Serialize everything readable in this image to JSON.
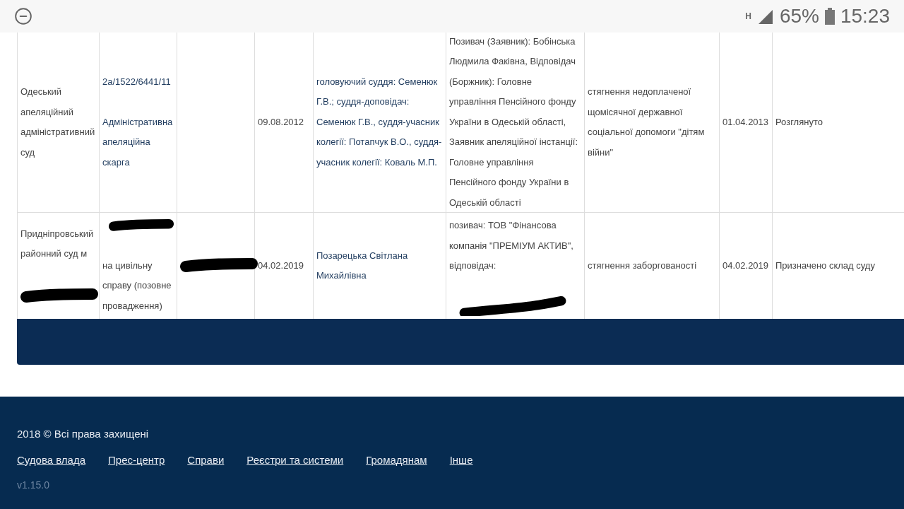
{
  "status_bar": {
    "network_type": "H",
    "battery": "65%",
    "time": "15:23"
  },
  "table": {
    "rows": [
      {
        "cells": [
          {
            "items": [
              {
                "kind": "text",
                "text": "Одеський апеляційний адміністративний суд"
              }
            ]
          },
          {
            "link": true,
            "items": [
              {
                "kind": "text",
                "text": "2а/1522/6441/11"
              },
              {
                "kind": "text",
                "text": "Адміністративна апеляційна скарга"
              }
            ]
          },
          {},
          {
            "items": [
              {
                "kind": "text",
                "text": "09.08.2012"
              }
            ]
          },
          {
            "link": true,
            "items": [
              {
                "kind": "text",
                "text": "головуючий суддя: Семенюк Г.В.; суддя-доповідач: Семенюк Г.В., суддя-учасник колегії: Потапчук В.О., суддя-учасник колегії: Коваль М.П."
              }
            ]
          },
          {
            "items": [
              {
                "kind": "text",
                "text": "Позивач (Заявник): Бобінська Людмила Факівна, Відповідач (Боржник): Головне управління Пенсійного фонду України в Одеській області, Заявник апеляційної інстанції: Головне управління Пенсійного фонду України в Одеській області"
              }
            ]
          },
          {
            "items": [
              {
                "kind": "text",
                "text": "стягнення недоплаченої щомісячної державної соціальної допомоги \"дітям війни\""
              }
            ]
          },
          {
            "items": [
              {
                "kind": "text",
                "text": "01.04.2013"
              }
            ]
          },
          {
            "items": [
              {
                "kind": "text",
                "text": "Розглянуто"
              }
            ]
          }
        ]
      },
      {
        "cells": [
          {
            "items": [
              {
                "kind": "text",
                "text": "Придніпровський районний суд м"
              },
              {
                "kind": "redaction"
              }
            ]
          },
          {
            "items": [
              {
                "kind": "redaction"
              },
              {
                "kind": "text",
                "text": "на цивільну справу (позовне провадження)"
              }
            ]
          },
          {
            "items": [
              {
                "kind": "redaction"
              }
            ]
          },
          {
            "items": [
              {
                "kind": "text",
                "text": "04.02.2019"
              }
            ]
          },
          {
            "link": true,
            "items": [
              {
                "kind": "text",
                "text": "Позарецька Світлана Михайлівна"
              }
            ]
          },
          {
            "items": [
              {
                "kind": "text",
                "text": "позивач: ТОВ \"Фінансова компанія \"ПРЕМІУМ АКТИВ\", відповідач:"
              },
              {
                "kind": "redaction"
              }
            ]
          },
          {
            "items": [
              {
                "kind": "text",
                "text": "стягнення заборгованості"
              }
            ]
          },
          {
            "items": [
              {
                "kind": "text",
                "text": "04.02.2019"
              }
            ]
          },
          {
            "items": [
              {
                "kind": "text",
                "text": "Призначено склад суду"
              }
            ]
          }
        ]
      }
    ]
  },
  "footer": {
    "copyright": "2018 © Всі права захищені",
    "links": [
      "Судова влада",
      "Прес-центр",
      "Справи",
      "Реєстри та системи",
      "Громадянам",
      "Інше"
    ],
    "version": "v1.15.0"
  }
}
